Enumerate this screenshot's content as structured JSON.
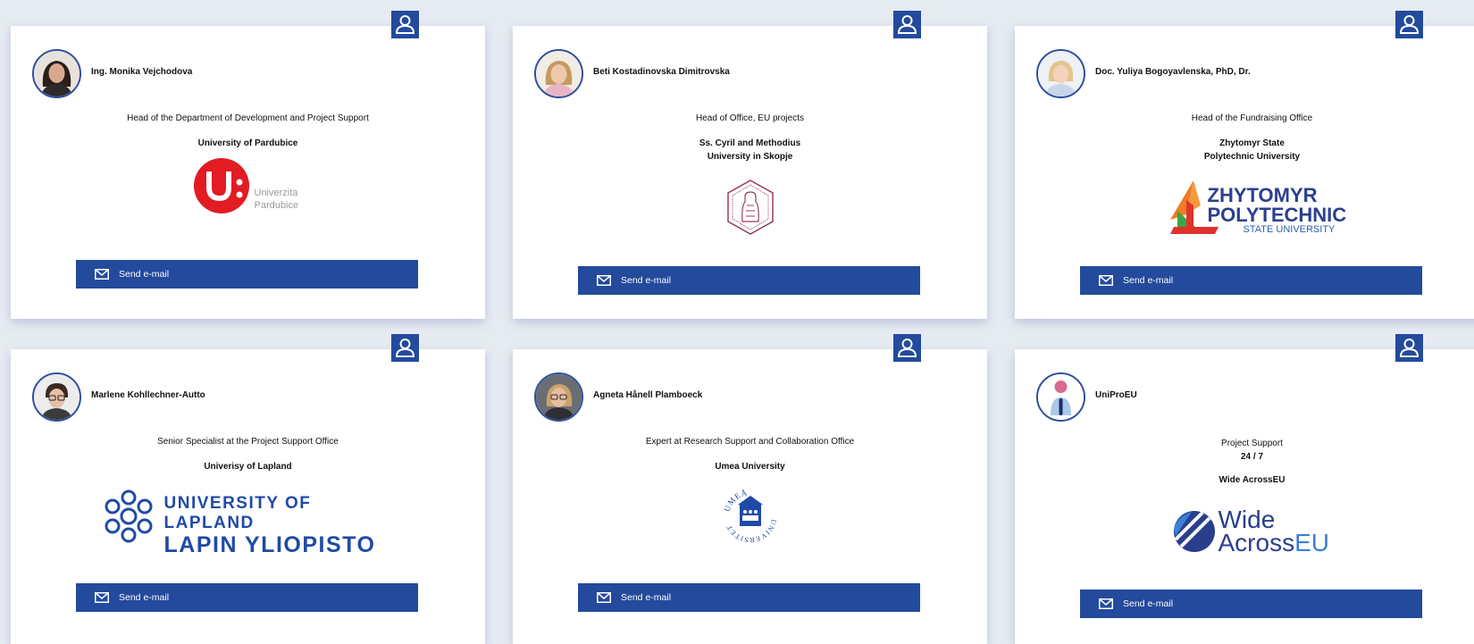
{
  "cards": [
    {
      "name": "Ing. Monika Vejchodova",
      "role": "Head of the Department of Development and Project Support",
      "institution_lines": [
        "University of Pardubice"
      ],
      "logo_text": [
        "Univerzita",
        "Pardubice"
      ],
      "email_label": "Send e-mail"
    },
    {
      "name": "Beti Kostadinovska Dimitrovska",
      "role": "Head of Office, EU projects",
      "institution_lines": [
        "Ss. Cyril and Methodius",
        "University in Skopje"
      ],
      "logo_text": [],
      "email_label": "Send e-mail"
    },
    {
      "name": "Doc. Yuliya Bogoyavlenska, PhD, Dr.",
      "role": "Head of the Fundraising Office",
      "institution_lines": [
        "Zhytomyr State",
        "Polytechnic University"
      ],
      "logo_text": [
        "ZHYTOMYR",
        "POLYTECHNIC",
        "STATE UNIVERSITY"
      ],
      "email_label": "Send e-mail"
    },
    {
      "name": "Marlene Kohllechner-Autto",
      "role": "Senior Specialist at the Project Support Office",
      "institution_lines": [
        "Univerisy of Lapland"
      ],
      "logo_text": [
        "UNIVERSITY OF LAPLAND",
        "LAPIN YLIOPISTO"
      ],
      "email_label": "Send e-mail"
    },
    {
      "name": "Agneta Hånell Plamboeck",
      "role": "Expert at Research Support and Collaboration Office",
      "institution_lines": [
        "Umea University"
      ],
      "logo_text": [
        "UMEÅ",
        "UNIVERSITET"
      ],
      "email_label": "Send e-mail"
    },
    {
      "name": "UniProEU",
      "role_lines": [
        "Project Support",
        "24 / 7"
      ],
      "institution_lines": [
        "Wide AcrossEU"
      ],
      "logo_text": [
        "Wide",
        "Across",
        "EU"
      ],
      "email_label": "Send e-mail"
    }
  ],
  "icons": {
    "badge": "user-icon",
    "email": "envelope-icon"
  },
  "colors": {
    "accent": "#234a9c",
    "card_bg": "#ffffff",
    "page_bg": "#e6ebf2"
  }
}
